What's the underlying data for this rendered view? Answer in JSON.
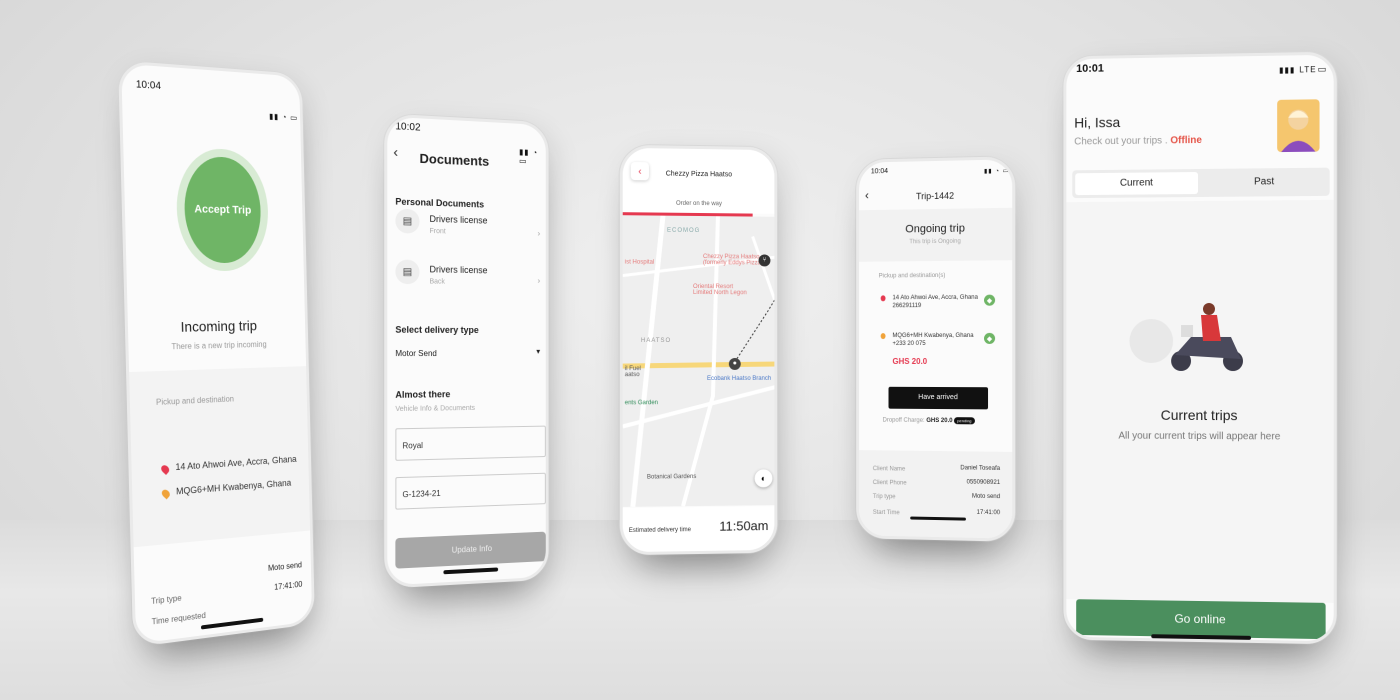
{
  "colors": {
    "accent_green": "#6fb566",
    "accent_red": "#e53950",
    "go_green": "#4b8f5e"
  },
  "phone1": {
    "time": "10:04",
    "accept_label": "Accept Trip",
    "title": "Incoming trip",
    "subtitle": "There is a new trip incoming",
    "pickup_label": "Pickup and destination",
    "pickup": "14 Ato Ahwoi Ave, Accra, Ghana",
    "destination": "MQG6+MH Kwabenya, Ghana",
    "trip_type_label": "Trip type",
    "trip_type": "Moto send",
    "time_requested_label": "Time requested",
    "time_requested": "17:41:00"
  },
  "phone2": {
    "time": "10:02",
    "title": "Documents",
    "personal_docs": "Personal Documents",
    "docs": [
      {
        "name": "Drivers license",
        "side": "Front"
      },
      {
        "name": "Drivers license",
        "side": "Back"
      }
    ],
    "delivery_label": "Select delivery type",
    "delivery_value": "Motor Send",
    "almost_title": "Almost there",
    "almost_sub": "Vehicle Info & Documents",
    "field1": "Royal",
    "field2": "G-1234-21",
    "update_btn": "Update Info"
  },
  "phone3": {
    "restaurant": "Chezzy Pizza Haatso",
    "status": "Order on the way",
    "map_labels": {
      "ecomog": "ECOMOG",
      "hospital": "ist Hospital",
      "pizza": "Chezzy Pizza Haatso (formerly Eddys Pizza)",
      "resort": "Oriental Resort Limited North Legon",
      "haatso": "HAATSO",
      "fuel": "il Fuel aatso",
      "ecobank": "Ecobank Haatso Branch",
      "garden": "ents Garden",
      "botanical": "Botanical Gardens"
    },
    "eta_label": "Estimated delivery time",
    "eta_value": "11:50am"
  },
  "phone4": {
    "time": "10:04",
    "title": "Trip-1442",
    "ongoing": "Ongoing trip",
    "ongoing_sub": "This trip is Ongoing",
    "pickup_label": "Pickup and destination(s)",
    "pickup_addr": "14 Ato Ahwoi Ave, Accra, Ghana",
    "pickup_phone": "266291119",
    "dest_addr": "MQG6+MH Kwabenya, Ghana",
    "dest_phone": "+233 20 075",
    "price": "GHS 20.0",
    "arrived_btn": "Have arrived",
    "dropoff_label": "Dropoff Charge:",
    "dropoff_value": "GHS 20.0",
    "dropoff_badge": "pending",
    "client_name_label": "Client Name",
    "client_name": "Daniel Toseafa",
    "client_phone_label": "Client Phone",
    "client_phone": "0550908921",
    "trip_type_label": "Trip type",
    "trip_type": "Moto send",
    "start_time_label": "Start Time",
    "start_time": "17:41:00"
  },
  "phone5": {
    "time": "10:01",
    "network": "LTE",
    "greeting": "Hi, Issa",
    "check": "Check out your trips .",
    "status": "Offline",
    "tab_current": "Current",
    "tab_past": "Past",
    "empty_title": "Current trips",
    "empty_sub": "All your current trips will appear here",
    "go_online": "Go online"
  }
}
